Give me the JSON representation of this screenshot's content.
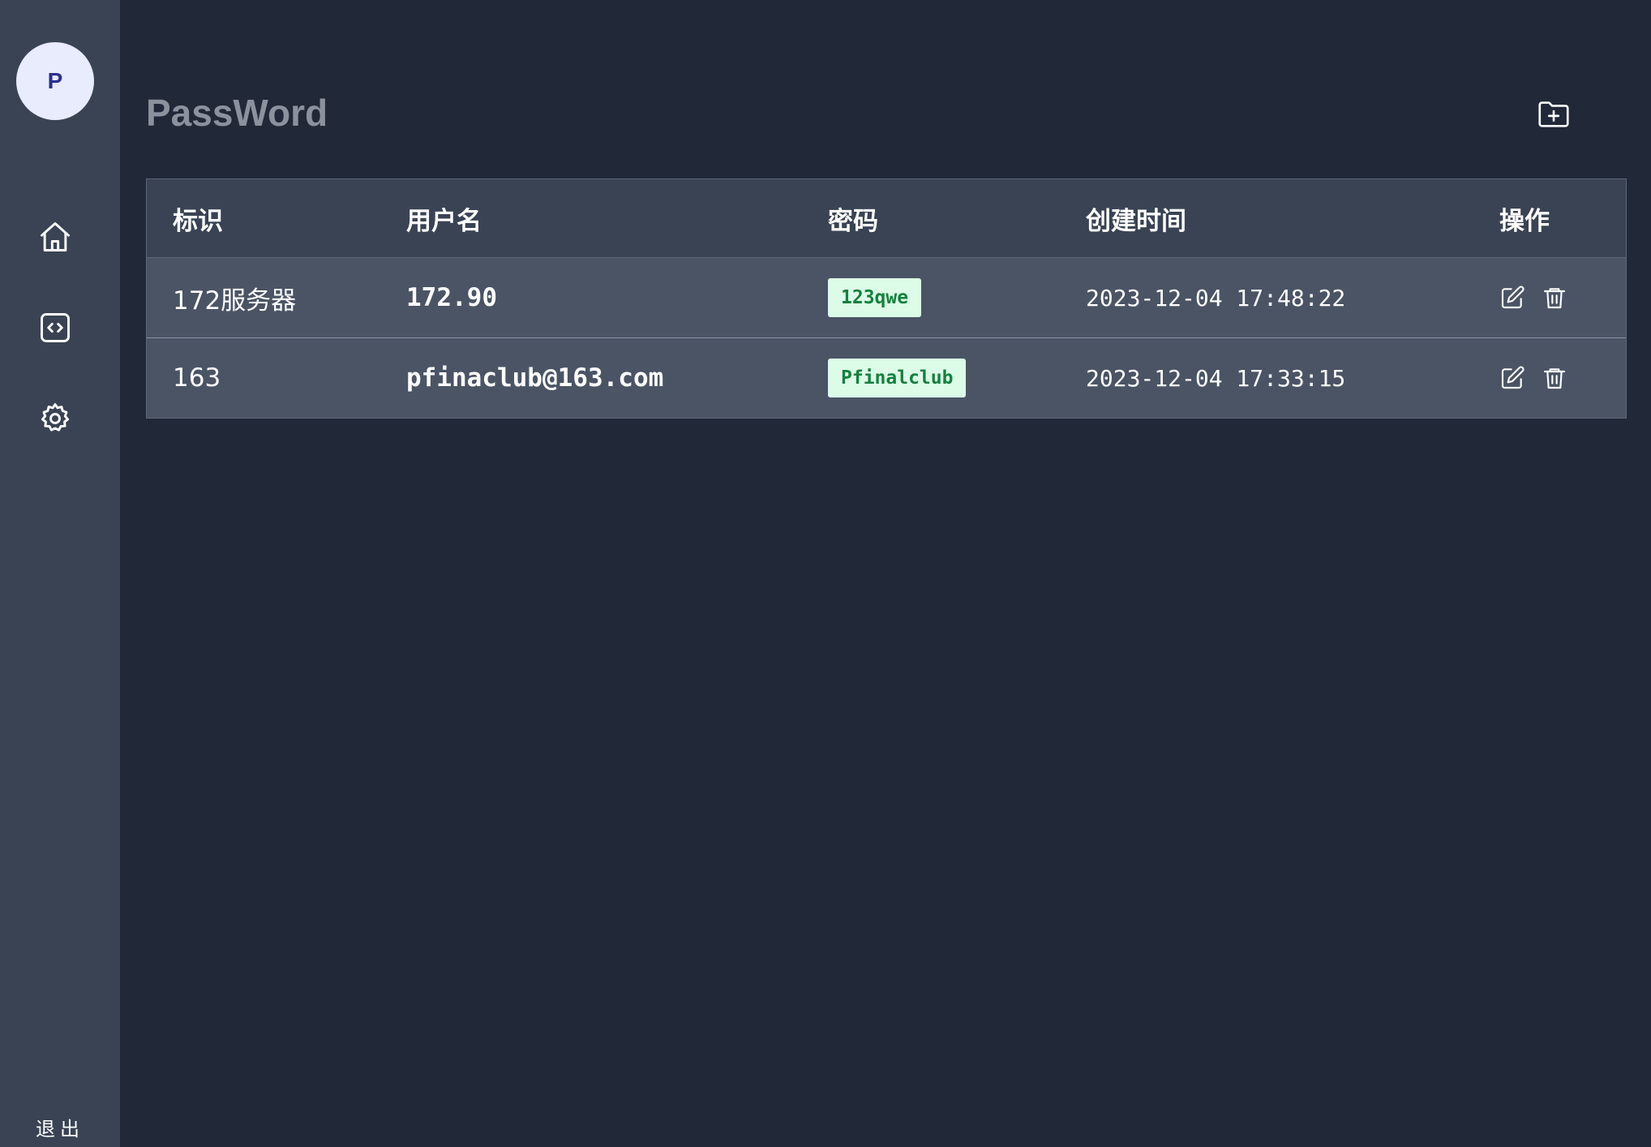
{
  "sidebar": {
    "avatar_letter": "P",
    "nav": [
      {
        "icon": "home-icon"
      },
      {
        "icon": "code-icon"
      },
      {
        "icon": "gear-icon"
      }
    ],
    "logout_label": "退出"
  },
  "header": {
    "title": "PassWord",
    "add_icon": "folder-plus-icon"
  },
  "table": {
    "columns": [
      "标识",
      "用户名",
      "密码",
      "创建时间",
      "操作"
    ],
    "rows": [
      {
        "label": "172服务器",
        "username": "172.90",
        "password": "123qwe",
        "created": "2023-12-04 17:48:22"
      },
      {
        "label": "163",
        "username": "pfinaclub@163.com",
        "password": "Pfinalclub",
        "created": "2023-12-04 17:33:15"
      }
    ]
  },
  "colors": {
    "background": "#212838",
    "sidebar": "#394354",
    "row": "#4a5465",
    "badge_bg": "#dcfce7",
    "badge_text": "#15803d"
  }
}
